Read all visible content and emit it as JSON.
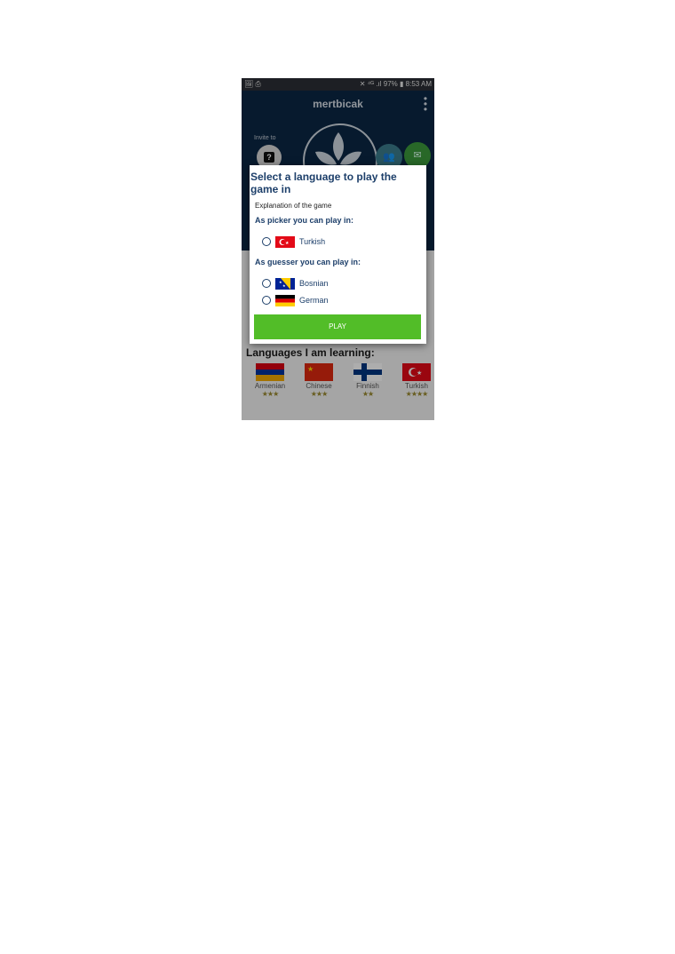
{
  "status_bar": {
    "left_icons": "🖼 ⎙",
    "right_text": "✕ ⁴ᴳ .ıl 97% ▮ 8:53 AM"
  },
  "header": {
    "app_title": "mertbicak",
    "invite_label": "Invite to",
    "invite_icon": "?"
  },
  "background": {
    "learning_title": "Languages I am learning:",
    "learning": [
      {
        "name": "Armenian",
        "stars": "★★★"
      },
      {
        "name": "Chinese",
        "stars": "★★★"
      },
      {
        "name": "Finnish",
        "stars": "★★"
      },
      {
        "name": "Turkish",
        "stars": "★★★★"
      }
    ]
  },
  "dialog": {
    "title": "Select a language to play the game in",
    "explanation": "Explanation of the game",
    "picker_label": "As picker you can play in:",
    "picker_options": [
      {
        "label": "Turkish",
        "flag": "turkey-flag"
      }
    ],
    "guesser_label": "As guesser you can play in:",
    "guesser_options": [
      {
        "label": "Bosnian",
        "flag": "bosnia-flag"
      },
      {
        "label": "German",
        "flag": "germany-flag"
      }
    ],
    "play_label": "PLAY"
  },
  "colors": {
    "header_bg": "#0b2745",
    "title_color": "#1d3f6a",
    "play_button": "#52bd28"
  }
}
